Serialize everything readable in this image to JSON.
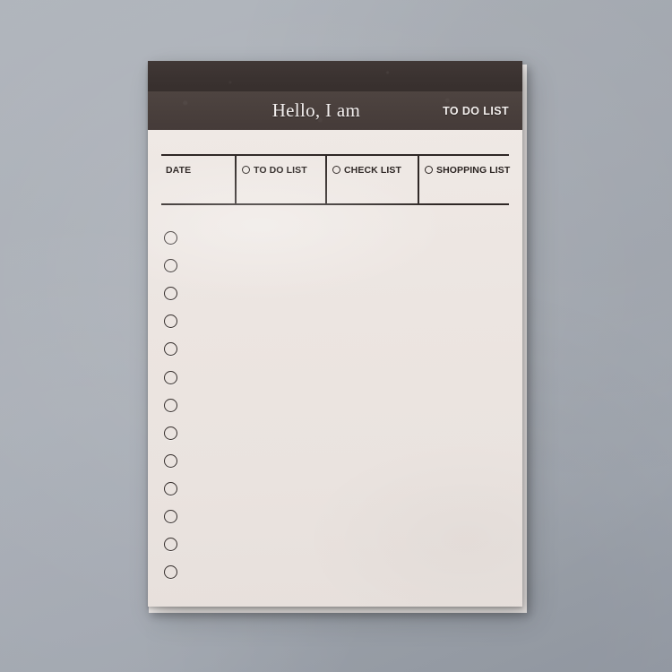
{
  "scene": {
    "background_color": "#a9aeb6",
    "description": "Flat-lay photo of a to do list notepad on a grey surface"
  },
  "notepad": {
    "paper_color": "#ece5e1",
    "header": {
      "band_top_color": "#3c3331",
      "band_bottom_color": "#4b413e",
      "title": "Hello, I am",
      "kicker": "TO DO LIST"
    },
    "table": {
      "rule_color": "#2e2725",
      "columns": [
        {
          "label": "DATE",
          "has_circle": false
        },
        {
          "label": "TO DO LIST",
          "has_circle": true
        },
        {
          "label": "CHECK LIST",
          "has_circle": true
        },
        {
          "label": "SHOPPING LIST",
          "has_circle": true
        }
      ]
    },
    "checklist": {
      "circle_count": 13,
      "circle_color": "#352e2c",
      "rows": [
        {
          "index": 1,
          "checked": false,
          "text": ""
        },
        {
          "index": 2,
          "checked": false,
          "text": ""
        },
        {
          "index": 3,
          "checked": false,
          "text": ""
        },
        {
          "index": 4,
          "checked": false,
          "text": ""
        },
        {
          "index": 5,
          "checked": false,
          "text": ""
        },
        {
          "index": 6,
          "checked": false,
          "text": ""
        },
        {
          "index": 7,
          "checked": false,
          "text": ""
        },
        {
          "index": 8,
          "checked": false,
          "text": ""
        },
        {
          "index": 9,
          "checked": false,
          "text": ""
        },
        {
          "index": 10,
          "checked": false,
          "text": ""
        },
        {
          "index": 11,
          "checked": false,
          "text": ""
        },
        {
          "index": 12,
          "checked": false,
          "text": ""
        },
        {
          "index": 13,
          "checked": false,
          "text": ""
        }
      ]
    }
  }
}
